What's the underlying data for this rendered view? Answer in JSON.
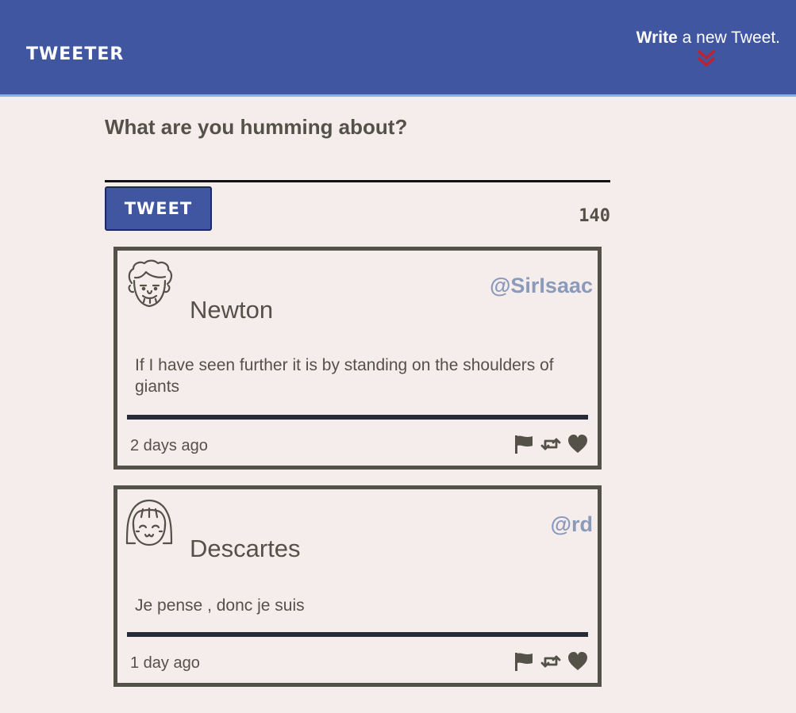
{
  "header": {
    "brand": "TWEETER",
    "compose_strong": "Write",
    "compose_rest": " a new Tweet."
  },
  "composer": {
    "prompt": "What are you humming about?",
    "input_value": "",
    "button_label": "TWEET",
    "counter": "140"
  },
  "tweets": [
    {
      "name": "Newton",
      "handle": "@SirIsaac",
      "text": "If I have seen further it is by standing on the shoulders of giants",
      "timestamp": "2 days ago",
      "avatar_icon": "man-curly-hair-avatar-icon"
    },
    {
      "name": "Descartes",
      "handle": "@rd",
      "text": "Je pense , donc je suis",
      "timestamp": "1 day ago",
      "avatar_icon": "woman-bangs-avatar-icon"
    }
  ],
  "icons": {
    "flag": "flag-icon",
    "retweet": "retweet-icon",
    "like": "heart-icon",
    "compose": "double-chevron-down-icon"
  },
  "colors": {
    "nav": "#4056a1",
    "nav_underline": "#7fb5ea",
    "background": "#f4edec",
    "text": "#545149",
    "handle": "#8b9aba",
    "chevron": "#c0212d",
    "divider": "#272b38"
  }
}
